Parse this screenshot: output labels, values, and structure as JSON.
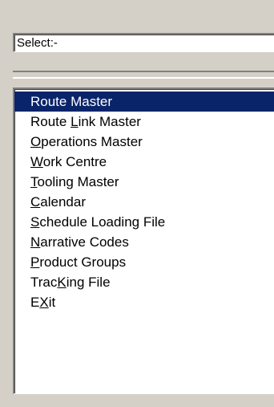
{
  "select": {
    "value": "Select:-"
  },
  "menu": {
    "items": [
      {
        "label": "Route Master",
        "pre": "Route Master",
        "key": "",
        "post": "",
        "selected": true
      },
      {
        "label": "Route Link Master",
        "pre": "Route ",
        "key": "L",
        "post": "ink Master",
        "selected": false
      },
      {
        "label": "Operations Master",
        "pre": "",
        "key": "O",
        "post": "perations Master",
        "selected": false
      },
      {
        "label": "Work Centre",
        "pre": "",
        "key": "W",
        "post": "ork Centre",
        "selected": false
      },
      {
        "label": "Tooling Master",
        "pre": "",
        "key": "T",
        "post": "ooling Master",
        "selected": false
      },
      {
        "label": "Calendar",
        "pre": "",
        "key": "C",
        "post": "alendar",
        "selected": false
      },
      {
        "label": "Schedule Loading File",
        "pre": "",
        "key": "S",
        "post": "chedule Loading File",
        "selected": false
      },
      {
        "label": "Narrative Codes",
        "pre": "",
        "key": "N",
        "post": "arrative Codes",
        "selected": false
      },
      {
        "label": "Product Groups",
        "pre": "",
        "key": "P",
        "post": "roduct Groups",
        "selected": false
      },
      {
        "label": "TracKing File",
        "pre": "Trac",
        "key": "K",
        "post": "ing File",
        "selected": false
      },
      {
        "label": "EXit",
        "pre": "E",
        "key": "X",
        "post": "it",
        "selected": false
      }
    ]
  },
  "colors": {
    "background": "#d4d0c8",
    "selection": "#0a246a",
    "selection_text": "#ffffff"
  }
}
